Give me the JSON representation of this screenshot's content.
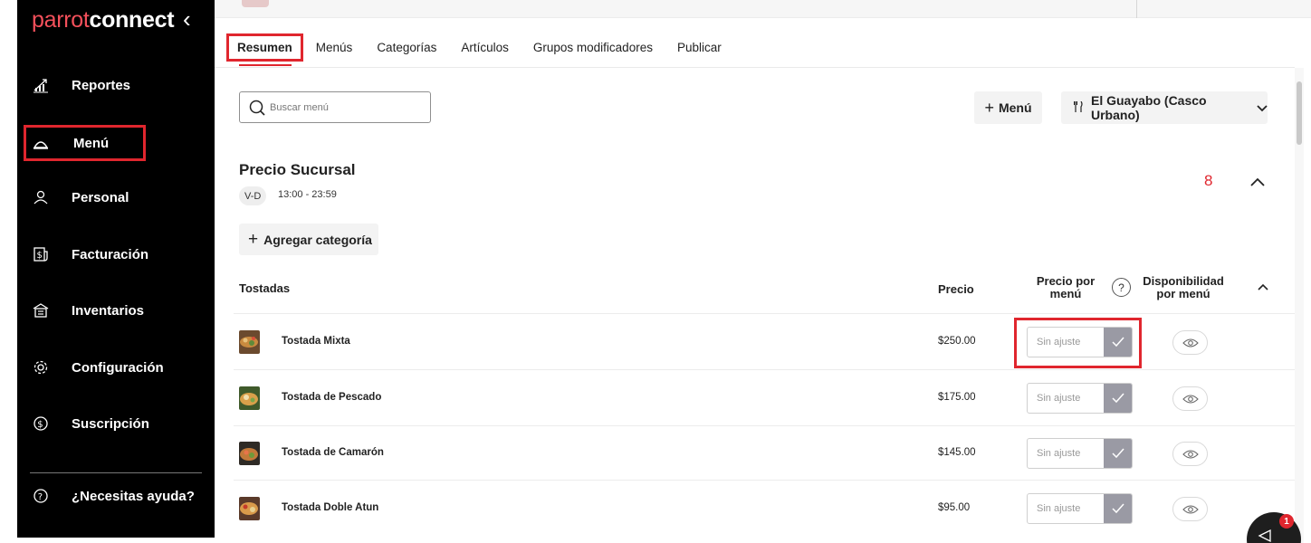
{
  "app": {
    "brand_part1": "parrot",
    "brand_part2": "connect"
  },
  "sidebar": {
    "items": [
      {
        "label": "Reportes",
        "icon": "chart-icon"
      },
      {
        "label": "Menú",
        "icon": "cloche-icon",
        "active": true
      },
      {
        "label": "Personal",
        "icon": "person-icon"
      },
      {
        "label": "Facturación",
        "icon": "invoice-icon"
      },
      {
        "label": "Inventarios",
        "icon": "warehouse-icon"
      },
      {
        "label": "Configuración",
        "icon": "gear-icon"
      },
      {
        "label": "Suscripción",
        "icon": "dollar-circle-icon"
      }
    ],
    "help": {
      "label": "¿Necesitas ayuda?",
      "icon": "question-circle-icon"
    }
  },
  "tabs": [
    {
      "label": "Resumen",
      "active": true
    },
    {
      "label": "Menús"
    },
    {
      "label": "Categorías"
    },
    {
      "label": "Artículos"
    },
    {
      "label": "Grupos modificadores"
    },
    {
      "label": "Publicar"
    }
  ],
  "toolbar": {
    "search_placeholder": "Buscar menú",
    "add_menu_label": "Menú",
    "branch_label": "El Guayabo (Casco Urbano)"
  },
  "section": {
    "title": "Precio Sucursal",
    "days": "V-D",
    "hours": "13:00 - 23:59",
    "count": "8",
    "add_category_label": "Agregar categoría"
  },
  "table": {
    "category": "Tostadas",
    "col_price": "Precio",
    "col_price_per_menu": "Precio por menú",
    "col_availability": "Disponibilidad por menú",
    "help_symbol": "?",
    "rows": [
      {
        "name": "Tostada Mixta",
        "price": "$250.00",
        "adjust_placeholder": "Sin ajuste"
      },
      {
        "name": "Tostada de Pescado",
        "price": "$175.00",
        "adjust_placeholder": "Sin ajuste"
      },
      {
        "name": "Tostada de Camarón",
        "price": "$145.00",
        "adjust_placeholder": "Sin ajuste"
      },
      {
        "name": "Tostada Doble Atun",
        "price": "$95.00",
        "adjust_placeholder": "Sin ajuste"
      }
    ]
  },
  "chat": {
    "badge": "1"
  },
  "colors": {
    "accent": "#e0262e",
    "sidebar_bg": "#000000",
    "confirm_bg": "#9a9aa4"
  }
}
